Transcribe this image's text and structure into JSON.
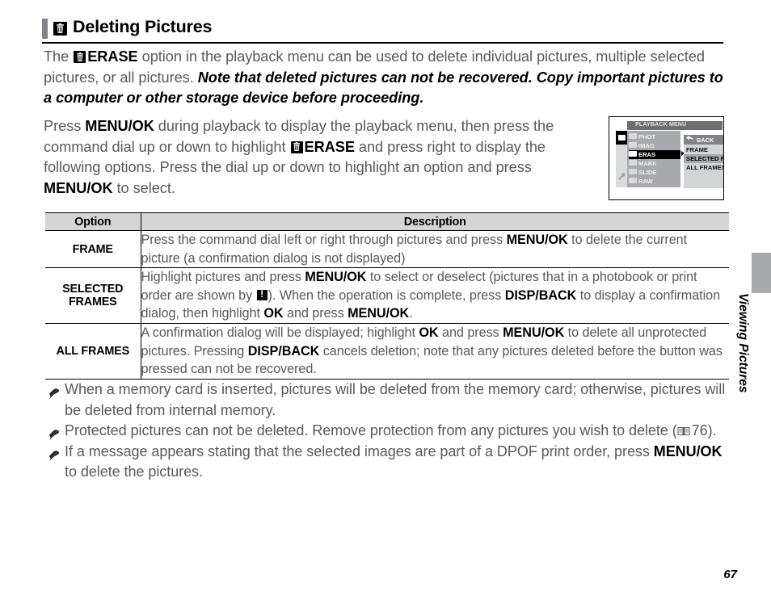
{
  "heading": {
    "icon": "trash-erase-icon",
    "title": "Deleting Pictures"
  },
  "paragraphs": {
    "intro_1": "The ",
    "intro_erase_label": "ERASE",
    "intro_2": " option in the playback menu can be used to delete individual pictures, multiple selected pictures, or all pictures. ",
    "intro_italic": "Note that deleted pictures can not be recovered.  Copy important pictures to a computer or other storage device before proceeding.",
    "press_1": "Press ",
    "press_menuok_1": "MENU/OK",
    "press_2": " during playback to display the playback menu, then press the command dial up or down to highlight ",
    "press_erase_label": "ERASE",
    "press_3": " and press right to display the following options.  Press the dial up or down to highlight an option and press ",
    "press_menuok_2": "MENU/OK",
    "press_4": " to select."
  },
  "camera_screen": {
    "title": "PLAYBACK MENU",
    "left_items": [
      {
        "label": "PHOT",
        "selected": false
      },
      {
        "label": "IMAG",
        "selected": false
      },
      {
        "label": "ERAS",
        "selected": true
      },
      {
        "label": "MARK",
        "selected": false
      },
      {
        "label": "SLIDE",
        "selected": false
      },
      {
        "label": "RAW",
        "selected": false
      }
    ],
    "back_label": "BACK",
    "options": [
      {
        "label": "FRAME",
        "selected": false
      },
      {
        "label": "SELECTED FRAMES",
        "selected": true
      },
      {
        "label": "ALL FRAMES",
        "selected": false
      }
    ]
  },
  "table": {
    "headers": {
      "option": "Option",
      "description": "Description"
    },
    "rows": [
      {
        "option": "FRAME",
        "desc_parts": [
          {
            "t": "Press the command dial left or right through pictures and press ",
            "b": false
          },
          {
            "t": "MENU/OK",
            "b": true
          },
          {
            "t": " to delete the current picture (a confirmation dialog is not displayed)",
            "b": false
          }
        ]
      },
      {
        "option": "SELECTED FRAMES",
        "desc_parts": [
          {
            "t": "Highlight pictures and press ",
            "b": false
          },
          {
            "t": "MENU/OK",
            "b": true
          },
          {
            "t": " to select or deselect (pictures that in a photobook or print order are shown by ",
            "b": false
          },
          {
            "t": "[warning-icon]",
            "b": false,
            "icon": "warning-icon"
          },
          {
            "t": ").  When the operation is complete, press ",
            "b": false
          },
          {
            "t": "DISP/BACK",
            "b": true
          },
          {
            "t": " to display a confirmation dialog, then highlight ",
            "b": false
          },
          {
            "t": "OK",
            "b": true
          },
          {
            "t": " and press ",
            "b": false
          },
          {
            "t": "MENU/OK",
            "b": true
          },
          {
            "t": ".",
            "b": false
          }
        ]
      },
      {
        "option": "ALL FRAMES",
        "desc_parts": [
          {
            "t": "A confirmation dialog will be displayed; highlight ",
            "b": false
          },
          {
            "t": "OK",
            "b": true
          },
          {
            "t": " and press ",
            "b": false
          },
          {
            "t": "MENU/OK",
            "b": true
          },
          {
            "t": " to delete all unprotected pictures.  Pressing ",
            "b": false
          },
          {
            "t": "DISP/BACK",
            "b": true
          },
          {
            "t": " cancels deletion; note that any pictures deleted before the button was pressed can not be recovered.",
            "b": false
          }
        ]
      }
    ]
  },
  "notes": [
    "When a memory card is inserted, pictures will be deleted from the memory card; otherwise, pictures will be deleted from internal memory.",
    "Protected pictures can not be deleted.  Remove protection from any pictures you wish to delete ( 76).",
    "If a message appears stating that the selected images are part of a DPOF print order, press MENU/OK to delete the pictures."
  ],
  "notes_detail": {
    "note2_pre": "Protected pictures can not be deleted.  Remove protection from any pictures you wish to delete (",
    "note2_ref": "76",
    "note2_post": ").",
    "note3_pre": "If a message appears stating that the selected images are part of a DPOF print order, press ",
    "note3_bold": "MENU/OK",
    "note3_post": " to delete the pictures."
  },
  "side_tab": {
    "label": "Viewing Pictures"
  },
  "page_number": "67",
  "colors": {
    "body_text": "#58595b",
    "emphasis": "#000000",
    "rule": "#000000",
    "header_fill": "#d4d5d7",
    "side_tab_fill": "#a7a9ac",
    "lcd_title_fill": "#6d6e71",
    "lcd_left_fill": "#a7a9ac",
    "lcd_right_fill": "#d3d4d6"
  }
}
